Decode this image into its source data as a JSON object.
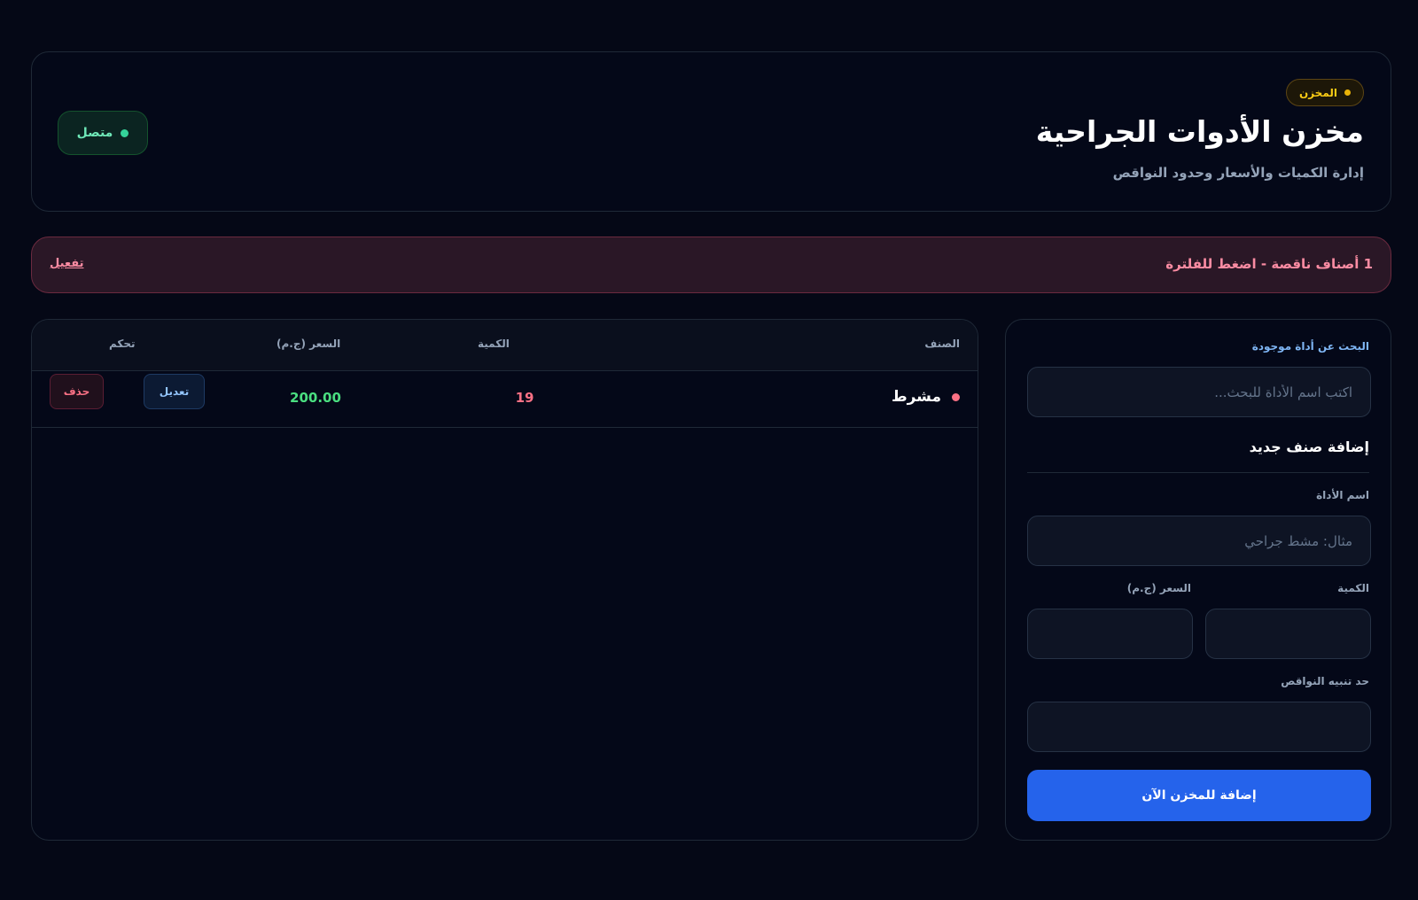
{
  "header": {
    "badge": "المخزن",
    "title": "مخزن الأدوات الجراحية",
    "subtitle": "إدارة الكميات والأسعار وحدود النواقص",
    "status": "متصل"
  },
  "alert": {
    "message": "1 أصناف ناقصة - اضغط للفلترة",
    "action": "تفعيل"
  },
  "table": {
    "columns": {
      "item": "الصنف",
      "quantity": "الكمية",
      "price": "السعر (ج.م)",
      "actions": "تحكم"
    },
    "rows": [
      {
        "name": "مشرط",
        "quantity": "19",
        "price": "200.00",
        "edit_label": "تعديل",
        "delete_label": "حذف"
      }
    ]
  },
  "form": {
    "search_label": "البحث عن أداة موجودة",
    "search_placeholder": "اكتب اسم الأداة للبحث...",
    "section_title": "إضافة صنف جديد",
    "name_label": "اسم الأداة",
    "name_placeholder": "مثال: مشط جراحي",
    "quantity_label": "الكمية",
    "quantity_value": "",
    "price_label": "السعر (ج.م)",
    "price_value": "",
    "threshold_label": "حد تنبيه النواقص",
    "threshold_value": "",
    "submit_label": "إضافة للمخزن الآن"
  }
}
